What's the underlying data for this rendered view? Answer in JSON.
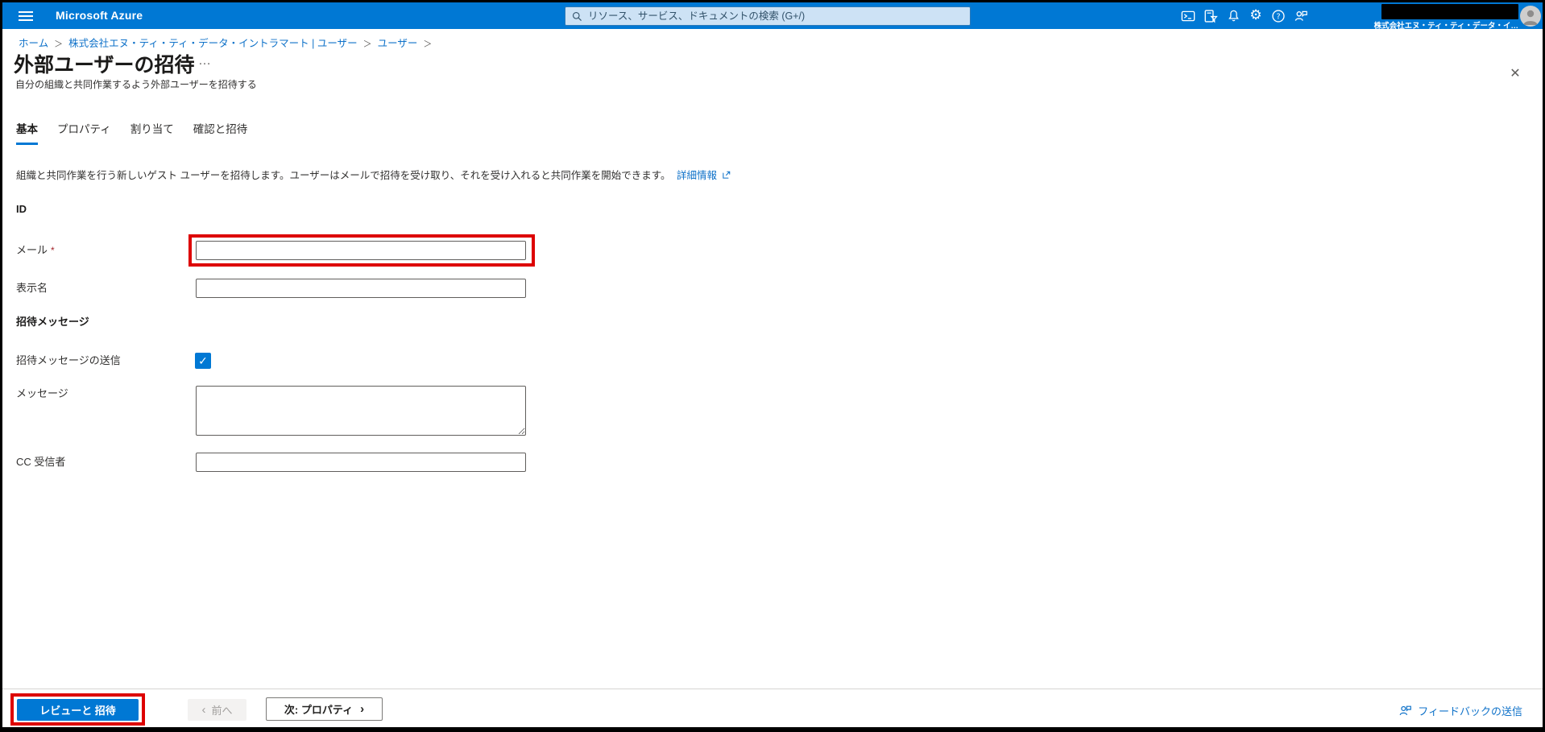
{
  "topbar": {
    "brand": "Microsoft Azure",
    "search_placeholder": "リソース、サービス、ドキュメントの検索 (G+/)",
    "tenant_name": "株式会社エヌ・ティ・ティ・データ・イ…"
  },
  "breadcrumb": {
    "items": [
      "ホーム",
      "株式会社エヌ・ティ・ティ・データ・イントラマート | ユーザー",
      "ユーザー"
    ],
    "separator": "＞"
  },
  "page": {
    "title": "外部ユーザーの招待",
    "subtitle": "自分の組織と共同作業するよう外部ユーザーを招待する"
  },
  "tabs": [
    {
      "label": "基本",
      "active": true
    },
    {
      "label": "プロパティ",
      "active": false
    },
    {
      "label": "割り当て",
      "active": false
    },
    {
      "label": "確認と招待",
      "active": false
    }
  ],
  "intro": {
    "text": "組織と共同作業を行う新しいゲスト ユーザーを招待します。ユーザーはメールで招待を受け取り、それを受け入れると共同作業を開始できます。",
    "link_label": "詳細情報"
  },
  "form": {
    "id_section_label": "ID",
    "email": {
      "label": "メール",
      "required_mark": "*",
      "value": "",
      "placeholder": ""
    },
    "display_name": {
      "label": "表示名",
      "value": ""
    },
    "invite_section_label": "招待メッセージ",
    "send_invite": {
      "label": "招待メッセージの送信",
      "checked": true
    },
    "message": {
      "label": "メッセージ",
      "value": ""
    },
    "cc": {
      "label": "CC 受信者",
      "value": ""
    }
  },
  "footer": {
    "review_invite_button": "レビューと 招待",
    "prev_button": "前へ",
    "next_button": "次: プロパティ",
    "feedback_link": "フィードバックの送信"
  },
  "icons": {
    "settings_gear_glyph": "⚙",
    "close_glyph": "✕",
    "ellipsis_glyph": "…",
    "check_glyph": "✓",
    "chevron_left_glyph": "‹",
    "chevron_right_glyph": "›"
  },
  "colors": {
    "topbar_blue": "#0078d4",
    "accent_blue": "#0078d4",
    "link_blue": "#0f72c9",
    "annotation_red": "#dd0000",
    "required_red": "#a4262c",
    "disabled_text": "#a19f9d"
  }
}
